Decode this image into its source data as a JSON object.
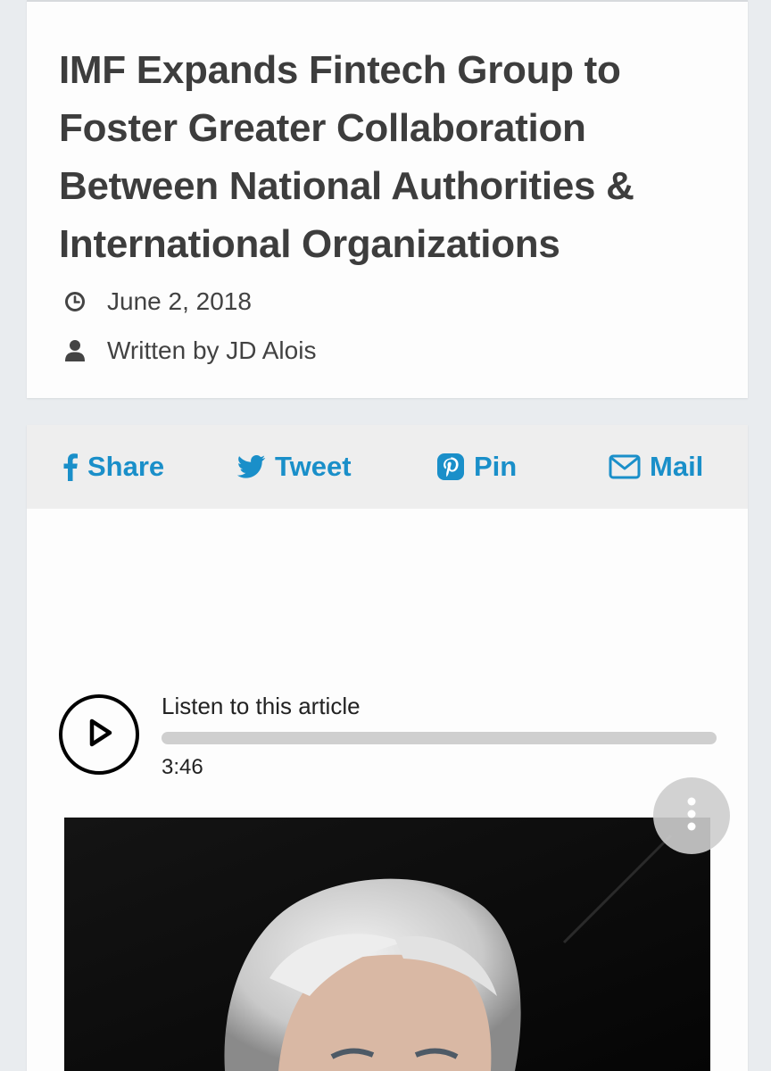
{
  "article": {
    "headline": "IMF Expands Fintech Group to Foster Greater Collaboration Between National Authorities & International Organizations",
    "date": "June 2, 2018",
    "author": "Written by JD Alois",
    "date_icon": "clock-icon",
    "author_icon": "user-icon"
  },
  "share": {
    "facebook": {
      "label": "Share",
      "icon": "facebook-icon"
    },
    "twitter": {
      "label": "Tweet",
      "icon": "twitter-icon"
    },
    "pinterest": {
      "label": "Pin",
      "icon": "pinterest-icon"
    },
    "mail": {
      "label": "Mail",
      "icon": "mail-icon"
    },
    "color": "#1a8fc9"
  },
  "audio_player": {
    "title": "Listen to this article",
    "duration": "3:46",
    "progress": 0,
    "play_icon": "play-icon"
  },
  "more_menu": {
    "icon": "vertical-dots-icon"
  },
  "colors": {
    "page_background": "#e9ecef",
    "card_background": "#fdfdfd",
    "headline": "#3d3d3d",
    "share_bar": "#eeeeee"
  }
}
